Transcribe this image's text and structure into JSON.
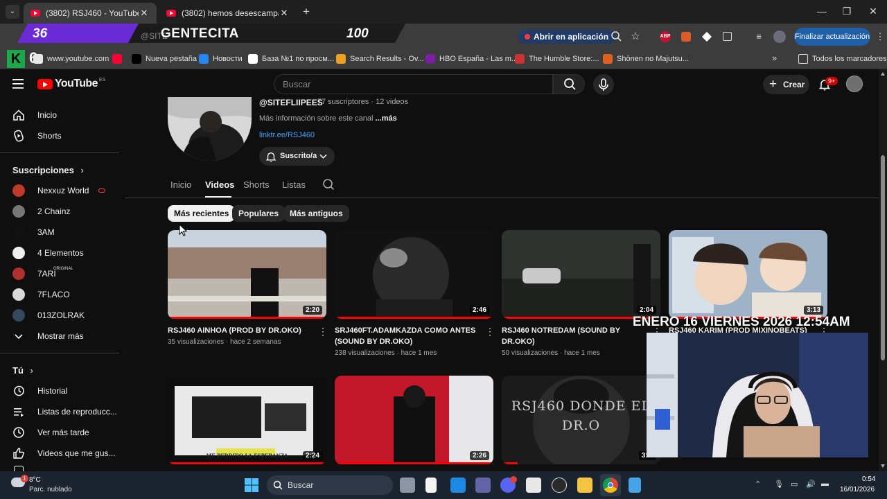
{
  "browser": {
    "tabs": [
      {
        "title": "(3802) RSJ460 - YouTube",
        "active": true
      },
      {
        "title": "(3802) hemos desescampao de",
        "active": false
      }
    ],
    "open_in_app": "Abrir en aplicación",
    "update_button": "Finalizar actualización",
    "overlay": {
      "left_number": "36",
      "center_text": "GENTECITA",
      "right_number": "100",
      "small_text": "@SITE",
      "badge_number": "6"
    },
    "bookmarks": [
      {
        "label": "www.youtube.com",
        "color": "#e8e8e8"
      },
      {
        "label": "",
        "color": "#ff0033"
      },
      {
        "label": "Nueva pestaña",
        "color": "#000000"
      },
      {
        "label": "Новости",
        "color": "#2787f5"
      },
      {
        "label": "База №1 по просм...",
        "color": "#ffffff"
      },
      {
        "label": "Search Results - Ov...",
        "color": "#f0a020"
      },
      {
        "label": "HBO España - Las m...",
        "color": "#7a1fa2"
      },
      {
        "label": "The Humble Store:...",
        "color": "#cc3333"
      },
      {
        "label": "Shōnen no Majutsu...",
        "color": "#e06020"
      }
    ],
    "all_bookmarks": "Todos los marcadores"
  },
  "youtube": {
    "logo_text": "YouTube",
    "logo_region": "ES",
    "search_placeholder": "Buscar",
    "create_label": "Crear",
    "notif_count": "9+",
    "sidebar": {
      "main": [
        {
          "label": "Inicio",
          "icon": "home-icon"
        },
        {
          "label": "Shorts",
          "icon": "shorts-icon"
        }
      ],
      "subscriptions_title": "Suscripciones",
      "subscriptions": [
        {
          "label": "Nexxuz World",
          "color": "#c0392b",
          "live": true
        },
        {
          "label": "2 Chainz",
          "color": "#777777"
        },
        {
          "label": "3AM",
          "color": "#111111"
        },
        {
          "label": "4 Elementos",
          "color": "#eeeeee"
        },
        {
          "label": "7ARI",
          "sup": "ORIGINAL",
          "color": "#b03030"
        },
        {
          "label": "7FLACO",
          "color": "#d9d9d9"
        },
        {
          "label": "013ZOLRAK",
          "color": "#34495e"
        }
      ],
      "show_more": "Mostrar más",
      "you_title": "Tú",
      "you_items": [
        {
          "label": "Historial",
          "icon": "history-icon"
        },
        {
          "label": "Listas de reproducc...",
          "icon": "playlists-icon"
        },
        {
          "label": "Ver más tarde",
          "icon": "watch-later-icon"
        },
        {
          "label": "Videos que me gus...",
          "icon": "like-icon"
        }
      ]
    },
    "channel": {
      "handle": "@SITEFLIIPEES",
      "stats": "· 77 suscriptores · 12 videos",
      "about": "Más información sobre este canal",
      "about_more": "...más",
      "link": "linktr.ee/RSJ460",
      "subscribed": "Suscrito/a",
      "tabs": [
        "Inicio",
        "Videos",
        "Shorts",
        "Listas"
      ],
      "active_tab": "Videos"
    },
    "filters": [
      "Más recientes",
      "Populares",
      "Más antiguos"
    ],
    "videos": [
      {
        "title": "RSJ460 AINHOA (PROD BY DR.OKO)",
        "views": "35 visualizaciones",
        "age": "hace 2 semanas",
        "duration": "2:20",
        "progress": 1.0
      },
      {
        "title": "SRJ460FT.ADAMKAZDA COMO ANTES (SOUND BY DR.OKO)",
        "views": "238 visualizaciones",
        "age": "hace 1 mes",
        "duration": "2:46",
        "progress": 1.0
      },
      {
        "title": "RSJ460 NOTREDAM (SOUND BY DR.OKO)",
        "views": "50 visualizaciones",
        "age": "hace 1 mes",
        "duration": "2:04",
        "progress": 1.0
      },
      {
        "title": "RSJ460 KARIM (PROD MIXINOBEATS)",
        "views": "",
        "age": "",
        "duration": "3:13",
        "progress": 1.0
      },
      {
        "title": "",
        "views": "",
        "age": "",
        "duration": "2:24",
        "progress": 1.0,
        "caption": "ME PERDIDO LA ESPERANZA"
      },
      {
        "title": "",
        "views": "",
        "age": "",
        "duration": "2:26",
        "progress": 1.0
      },
      {
        "title": "",
        "views": "",
        "age": "",
        "duration": "3:...",
        "progress": 0.1,
        "caption": "RSJ460 DONDE EL DR.O"
      }
    ]
  },
  "stream_overlay": {
    "datetime": "ENERO 16 VIERNES 2026 12:54AM"
  },
  "taskbar": {
    "weather_temp": "8°C",
    "weather_desc": "Parc. nublado",
    "weather_badge": "1",
    "search_label": "Buscar",
    "time": "0:54",
    "date": "16/01/2026"
  }
}
